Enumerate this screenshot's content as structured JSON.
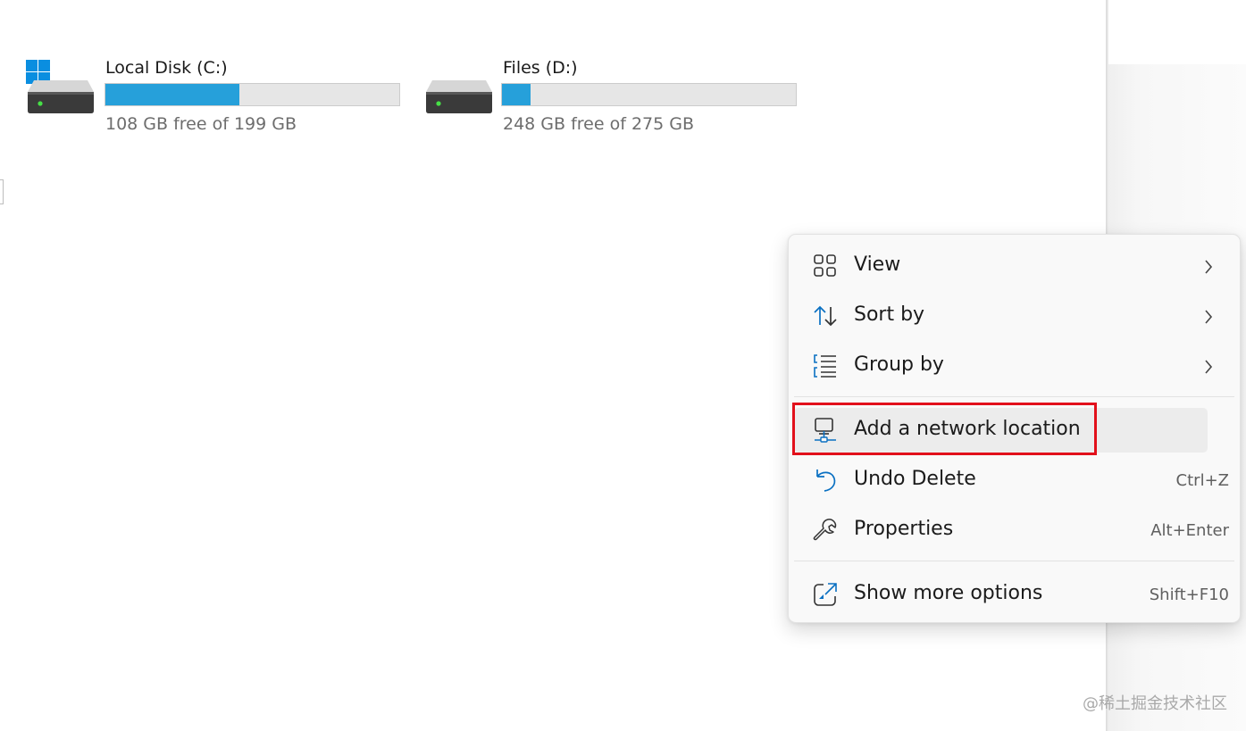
{
  "drives": [
    {
      "name": "Local Disk (C:)",
      "free_text": "108 GB free of 199 GB",
      "used_fraction": 0.457,
      "icon": "windows-drive-icon"
    },
    {
      "name": "Files (D:)",
      "free_text": "248 GB free of 275 GB",
      "used_fraction": 0.098,
      "icon": "drive-icon"
    }
  ],
  "context_menu": {
    "items": [
      {
        "label": "View",
        "icon": "grid-view-icon",
        "submenu": true
      },
      {
        "label": "Sort by",
        "icon": "sort-arrows-icon",
        "submenu": true
      },
      {
        "label": "Group by",
        "icon": "group-list-icon",
        "submenu": true
      },
      {
        "label": "Add a network location",
        "icon": "network-location-icon",
        "hovered": true
      },
      {
        "label": "Undo Delete",
        "icon": "undo-icon",
        "shortcut": "Ctrl+Z"
      },
      {
        "label": "Properties",
        "icon": "wrench-icon",
        "shortcut": "Alt+Enter"
      },
      {
        "label": "Show more options",
        "icon": "share-box-icon",
        "shortcut": "Shift+F10"
      }
    ]
  },
  "watermark": "@稀土掘金技术社区",
  "colors": {
    "usage_bar": "#26a0da",
    "usage_track": "#e6e6e6",
    "highlight_box": "#e2101b",
    "menu_background": "#f9f9f9",
    "icon_accent": "#0a70c2"
  }
}
